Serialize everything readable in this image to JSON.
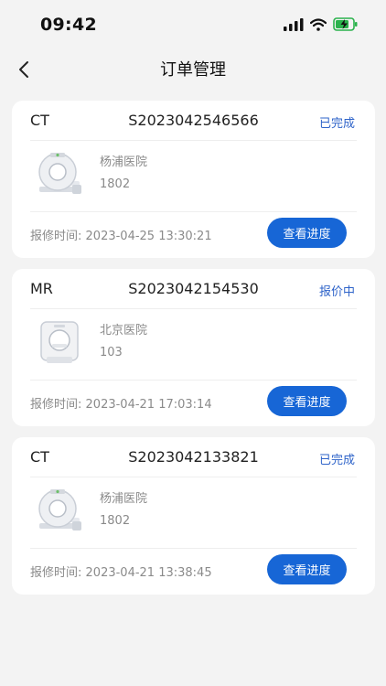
{
  "status_bar": {
    "time": "09:42"
  },
  "nav": {
    "title": "订单管理"
  },
  "colors": {
    "accent": "#1766d6",
    "status_text": "#2e63c9",
    "background": "#f3f3f3"
  },
  "report_time_label": "报修时间:",
  "progress_button_label": "查看进度",
  "orders": [
    {
      "modality": "CT",
      "order_no": "S2023042546566",
      "status": "已完成",
      "hospital": "杨浦医院",
      "room": "1802",
      "report_time": "2023-04-25 13:30:21",
      "device_icon": "ct-scanner-icon"
    },
    {
      "modality": "MR",
      "order_no": "S2023042154530",
      "status": "报价中",
      "hospital": "北京医院",
      "room": "103",
      "report_time": "2023-04-21 17:03:14",
      "device_icon": "mri-scanner-icon"
    },
    {
      "modality": "CT",
      "order_no": "S2023042133821",
      "status": "已完成",
      "hospital": "杨浦医院",
      "room": "1802",
      "report_time": "2023-04-21 13:38:45",
      "device_icon": "ct-scanner-icon"
    }
  ]
}
